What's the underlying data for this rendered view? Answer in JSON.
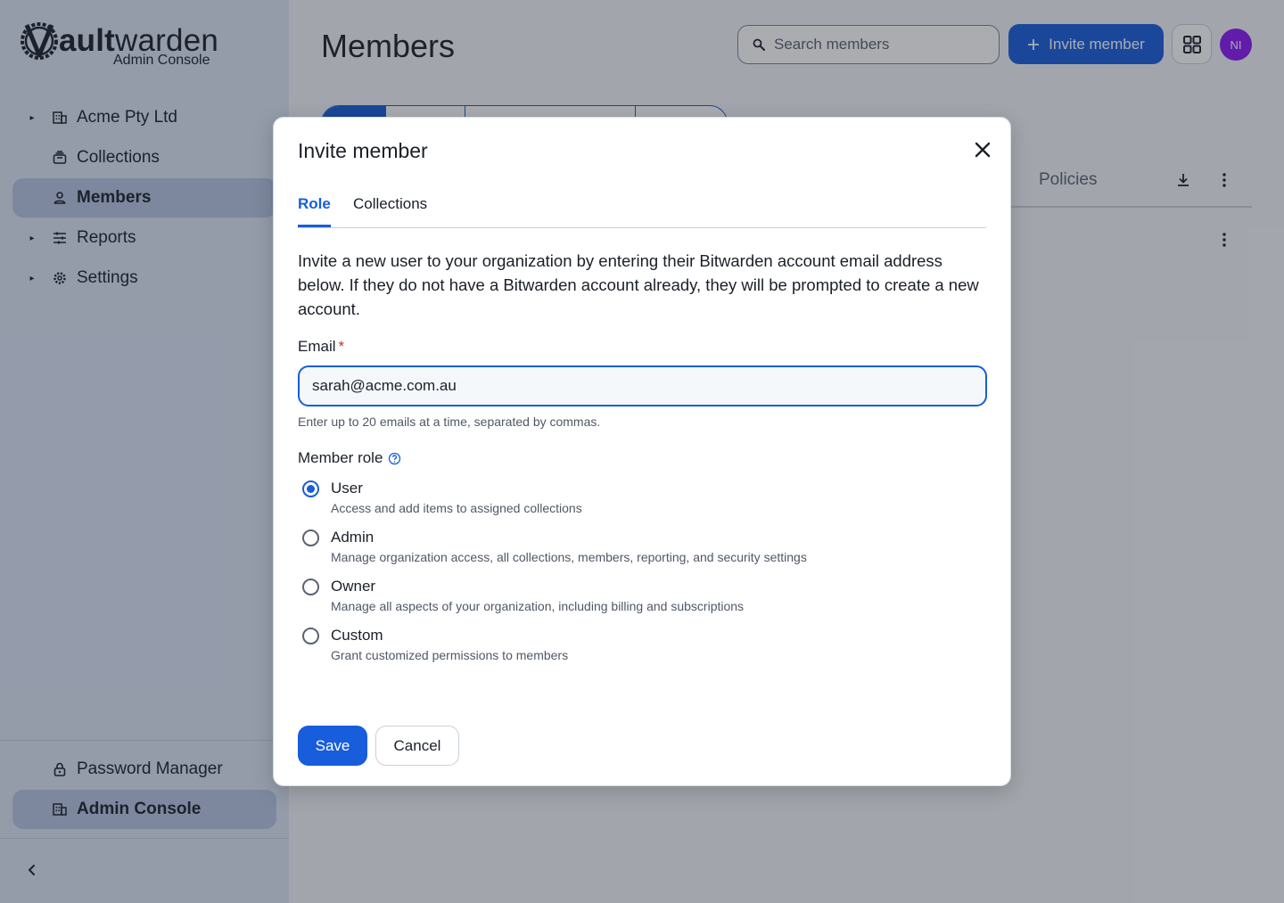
{
  "sidebar": {
    "logo": {
      "brand": "Vaultwarden",
      "subtitle": "Admin Console"
    },
    "org_item": "Acme Pty Ltd",
    "items": [
      {
        "label": "Collections"
      },
      {
        "label": "Members"
      },
      {
        "label": "Reports"
      },
      {
        "label": "Settings"
      }
    ],
    "bottom": [
      {
        "label": "Password Manager"
      },
      {
        "label": "Admin Console"
      }
    ]
  },
  "header": {
    "title": "Members",
    "search_placeholder": "Search members",
    "invite_button": "Invite member",
    "avatar_initials": "NI"
  },
  "table": {
    "policies_header": "Policies"
  },
  "dialog": {
    "title": "Invite member",
    "tabs": [
      "Role",
      "Collections"
    ],
    "intro": "Invite a new user to your organization by entering their Bitwarden account email address below. If they do not have a Bitwarden account already, they will be prompted to create a new account.",
    "email_label": "Email",
    "email_required_mark": "*",
    "email_value": "sarah@acme.com.au",
    "email_hint": "Enter up to 20 emails at a time, separated by commas.",
    "role_label": "Member role",
    "roles": [
      {
        "title": "User",
        "desc": "Access and add items to assigned collections",
        "selected": true
      },
      {
        "title": "Admin",
        "desc": "Manage organization access, all collections, members, reporting, and security settings",
        "selected": false
      },
      {
        "title": "Owner",
        "desc": "Manage all aspects of your organization, including billing and subscriptions",
        "selected": false
      },
      {
        "title": "Custom",
        "desc": "Grant customized permissions to members",
        "selected": false
      }
    ],
    "save_button": "Save",
    "cancel_button": "Cancel"
  },
  "colors": {
    "accent": "#175ddc",
    "sidebar_bg": "#dbe5f6",
    "avatar_bg": "#8a18f5",
    "required": "#c83522"
  }
}
